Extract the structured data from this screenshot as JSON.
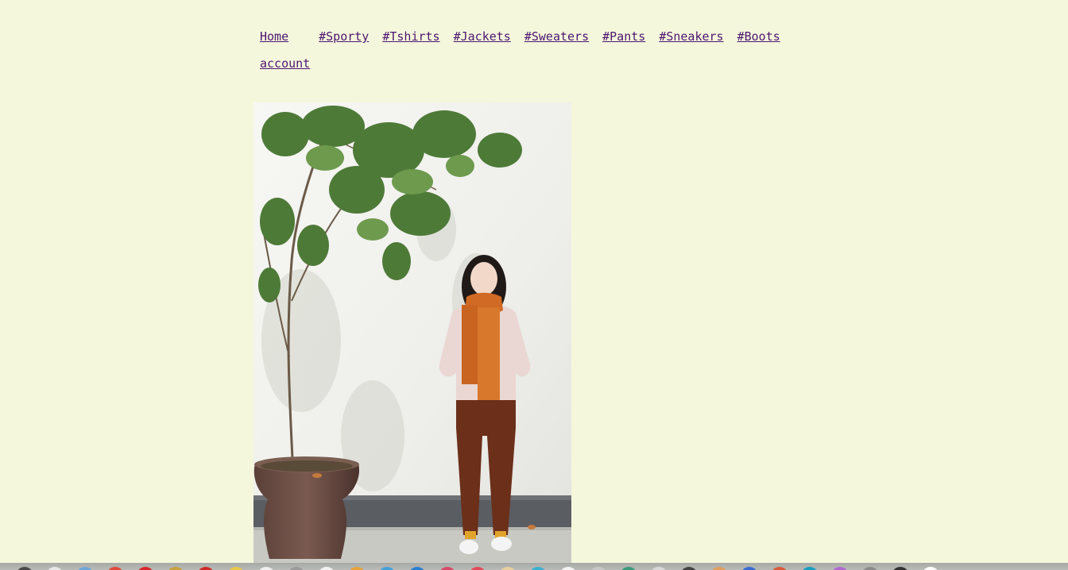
{
  "nav": {
    "links": [
      {
        "label": "Home"
      },
      {
        "label": "#Sporty"
      },
      {
        "label": "#Tshirts"
      },
      {
        "label": "#Jackets"
      },
      {
        "label": "#Sweaters"
      },
      {
        "label": "#Pants"
      },
      {
        "label": "#Sneakers"
      },
      {
        "label": "#Boots"
      }
    ],
    "account_label": "account"
  },
  "colors": {
    "background": "#f5f7dc",
    "link": "#4b1670",
    "dock": "#b0b2af"
  },
  "photo": {
    "subject": "woman-in-orange-scarf-beside-potted-tree-photo"
  },
  "dock": {
    "icons": [
      {
        "name": "app-icon",
        "color": "#4a4a4a"
      },
      {
        "name": "app-icon",
        "color": "#e9e9e9"
      },
      {
        "name": "app-icon",
        "color": "#6fa6d8"
      },
      {
        "name": "app-icon",
        "color": "#e04a3a"
      },
      {
        "name": "app-icon",
        "color": "#d9262c"
      },
      {
        "name": "app-icon",
        "color": "#c8a23c"
      },
      {
        "name": "app-icon",
        "color": "#cf2a2a"
      },
      {
        "name": "app-icon",
        "color": "#e8c94a"
      },
      {
        "name": "app-icon",
        "color": "#f0f0f0"
      },
      {
        "name": "app-icon",
        "color": "#9a9a9a"
      },
      {
        "name": "app-icon",
        "color": "#f2f2f2"
      },
      {
        "name": "app-icon",
        "color": "#e8a23a"
      },
      {
        "name": "app-icon",
        "color": "#46a0d8"
      },
      {
        "name": "app-icon",
        "color": "#2a7fd0"
      },
      {
        "name": "app-icon",
        "color": "#d84a6a"
      },
      {
        "name": "app-icon",
        "color": "#e04a5a"
      },
      {
        "name": "app-icon",
        "color": "#e8d0a0"
      },
      {
        "name": "app-icon",
        "color": "#3ab0d0"
      },
      {
        "name": "app-icon",
        "color": "#f4f4f4"
      },
      {
        "name": "app-icon",
        "color": "#c8c8c8"
      },
      {
        "name": "app-icon",
        "color": "#3a9a7a"
      },
      {
        "name": "app-icon",
        "color": "#d8d8d8"
      },
      {
        "name": "app-icon",
        "color": "#444444"
      },
      {
        "name": "app-icon",
        "color": "#e0a060"
      },
      {
        "name": "app-icon",
        "color": "#3a6ad0"
      },
      {
        "name": "app-icon",
        "color": "#d85a3a"
      },
      {
        "name": "app-icon",
        "color": "#1aa0c0"
      },
      {
        "name": "app-icon",
        "color": "#b06ad0"
      },
      {
        "name": "app-icon",
        "color": "#8a8a8a"
      },
      {
        "name": "app-icon",
        "color": "#333333"
      },
      {
        "name": "app-icon",
        "color": "#ffffff"
      }
    ]
  }
}
